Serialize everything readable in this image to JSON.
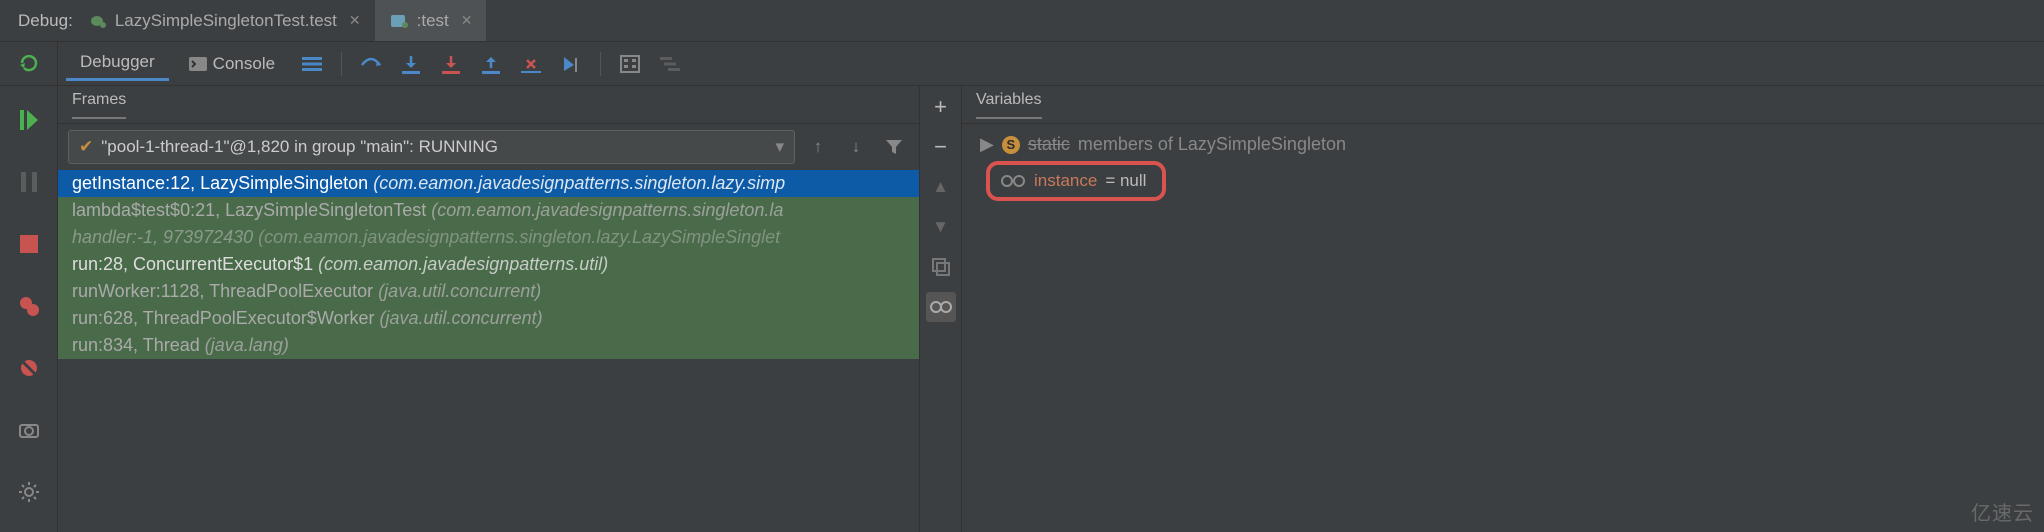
{
  "header": {
    "debug_label": "Debug:",
    "tabs": [
      {
        "label": "LazySimpleSingletonTest.test"
      },
      {
        "label": ":test"
      }
    ]
  },
  "toolbar": {
    "debugger_tab": "Debugger",
    "console_tab": "Console"
  },
  "frames": {
    "panel_title": "Frames",
    "thread_selector": "\"pool-1-thread-1\"@1,820 in group \"main\": RUNNING",
    "rows": [
      {
        "method": "getInstance:12, LazySimpleSingleton",
        "pkg": "(com.eamon.javadesignpatterns.singleton.lazy.simp",
        "style": "selected"
      },
      {
        "method": "lambda$test$0:21, LazySimpleSingletonTest",
        "pkg": "(com.eamon.javadesignpatterns.singleton.la",
        "style": "dimmed"
      },
      {
        "method": "handler:-1, 973972430",
        "pkg": "(com.eamon.javadesignpatterns.singleton.lazy.LazySimpleSinglet",
        "style": "dimmed"
      },
      {
        "method": "run:28, ConcurrentExecutor$1",
        "pkg": "(com.eamon.javadesignpatterns.util)",
        "style": "semi"
      },
      {
        "method": "runWorker:1128, ThreadPoolExecutor",
        "pkg": "(java.util.concurrent)",
        "style": "dimmed"
      },
      {
        "method": "run:628, ThreadPoolExecutor$Worker",
        "pkg": "(java.util.concurrent)",
        "style": "dimmed"
      },
      {
        "method": "run:834, Thread",
        "pkg": "(java.lang)",
        "style": "dimmed"
      }
    ]
  },
  "variables": {
    "panel_title": "Variables",
    "static_label": "static",
    "static_desc": "members of LazySimpleSingleton",
    "instance_name": "instance",
    "instance_value": " = null"
  },
  "watermark": "亿速云"
}
